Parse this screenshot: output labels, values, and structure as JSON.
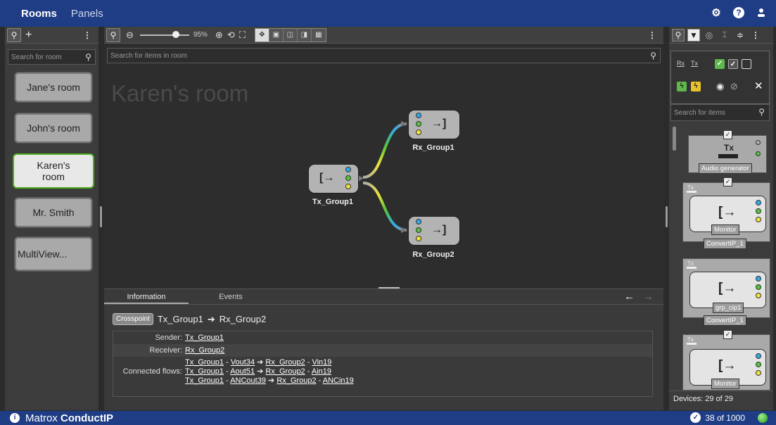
{
  "nav": {
    "rooms": "Rooms",
    "panels": "Panels"
  },
  "top_icons": [
    "gear-icon",
    "help-icon",
    "user-icon"
  ],
  "left": {
    "search_placeholder": "Search for room",
    "rooms": [
      "Jane's room",
      "John's room",
      "Karen's room",
      "Mr. Smith",
      "MultiView..."
    ],
    "selected": "Karen's room"
  },
  "center": {
    "search_placeholder": "Search for items in room",
    "zoom": "95%",
    "room_title": "Karen's room",
    "nodes": {
      "tx": "Tx_Group1",
      "rx1": "Rx_Group1",
      "rx2": "Rx_Group2"
    }
  },
  "info": {
    "tab_information": "Information",
    "tab_events": "Events",
    "badge": "Crosspoint",
    "cross_from": "Tx_Group1",
    "cross_arrow": "➔",
    "cross_to": "Rx_Group2",
    "sender_label": "Sender:",
    "sender": "Tx_Group1",
    "receiver_label": "Receiver:",
    "receiver": "Rx_Group2",
    "flows_label": "Connected flows:",
    "flows": [
      {
        "tx": "Tx_Group1",
        "tx_flow": "Vout34",
        "rx": "Rx_Group2",
        "rx_flow": "Vin19"
      },
      {
        "tx": "Tx_Group1",
        "tx_flow": "Aout51",
        "rx": "Rx_Group2",
        "rx_flow": "Ain19"
      },
      {
        "tx": "Tx_Group1",
        "tx_flow": "ANCout39",
        "rx": "Rx_Group2",
        "rx_flow": "ANCin19"
      }
    ]
  },
  "right": {
    "search_placeholder": "Search for items",
    "filter_rx": "Rx",
    "filter_tx": "Tx",
    "devices": [
      {
        "tag": "Audio generator",
        "label": "Tx"
      },
      {
        "tag": "ConvertIP_1",
        "inner": "Monitor",
        "label": "Tx"
      },
      {
        "tag": "ConvertIP_1",
        "inner": "grp_cip1",
        "label": "Tx"
      },
      {
        "inner": "Monitor",
        "label": "Tx"
      }
    ],
    "device_count": "Devices: 29 of 29"
  },
  "bottom": {
    "brand_light": "Matrox",
    "brand_bold": "ConductIP",
    "counter": "38 of 1000"
  },
  "colors": {
    "bar": "#1e3d85",
    "selected_border": "#4caf1e"
  }
}
